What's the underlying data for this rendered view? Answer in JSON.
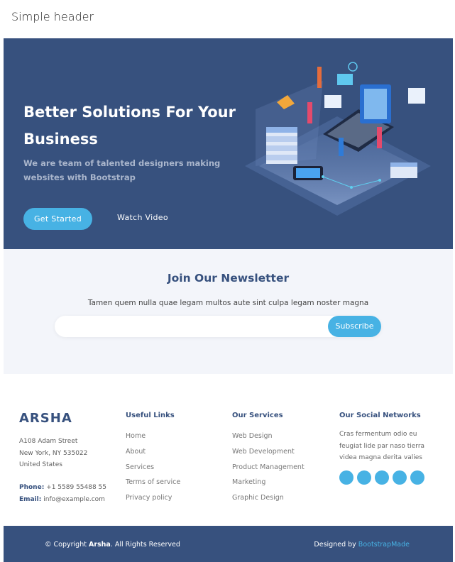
{
  "page": {
    "title": "Simple header"
  },
  "hero": {
    "heading": "Better Solutions For Your Business",
    "subheading": "We are team of talented designers making websites with Bootstrap",
    "get_started_label": "Get Started",
    "watch_video_label": "Watch Video"
  },
  "newsletter": {
    "title": "Join Our Newsletter",
    "text": "Tamen quem nulla quae legam multos aute sint culpa legam noster magna",
    "email_value": "",
    "subscribe_label": "Subscribe"
  },
  "footer": {
    "brand": "ARSHA",
    "address": [
      "A108 Adam Street",
      "New York, NY 535022",
      "United States"
    ],
    "phone_label": "Phone:",
    "phone": "+1 5589 55488 55",
    "email_label": "Email:",
    "email": "info@example.com",
    "useful_links": {
      "title": "Useful Links",
      "items": [
        "Home",
        "About",
        "Services",
        "Terms of service",
        "Privacy policy"
      ]
    },
    "services": {
      "title": "Our Services",
      "items": [
        "Web Design",
        "Web Development",
        "Product Management",
        "Marketing",
        "Graphic Design"
      ]
    },
    "social": {
      "title": "Our Social Networks",
      "text": "Cras fermentum odio eu feugiat lide par naso tierra videa magna derita valies",
      "icons": [
        "twitter-icon",
        "facebook-icon",
        "instagram-icon",
        "skype-icon",
        "linkedin-icon"
      ]
    },
    "copyright_prefix": "© Copyright ",
    "copyright_brand": "Arsha",
    "copyright_suffix": ". All Rights Reserved",
    "designed_by_prefix": "Designed by ",
    "designed_by_link": "BootstrapMade"
  },
  "colors": {
    "primary_dark": "#37517e",
    "accent": "#47b2e4",
    "light_bg": "#f3f5fa"
  }
}
